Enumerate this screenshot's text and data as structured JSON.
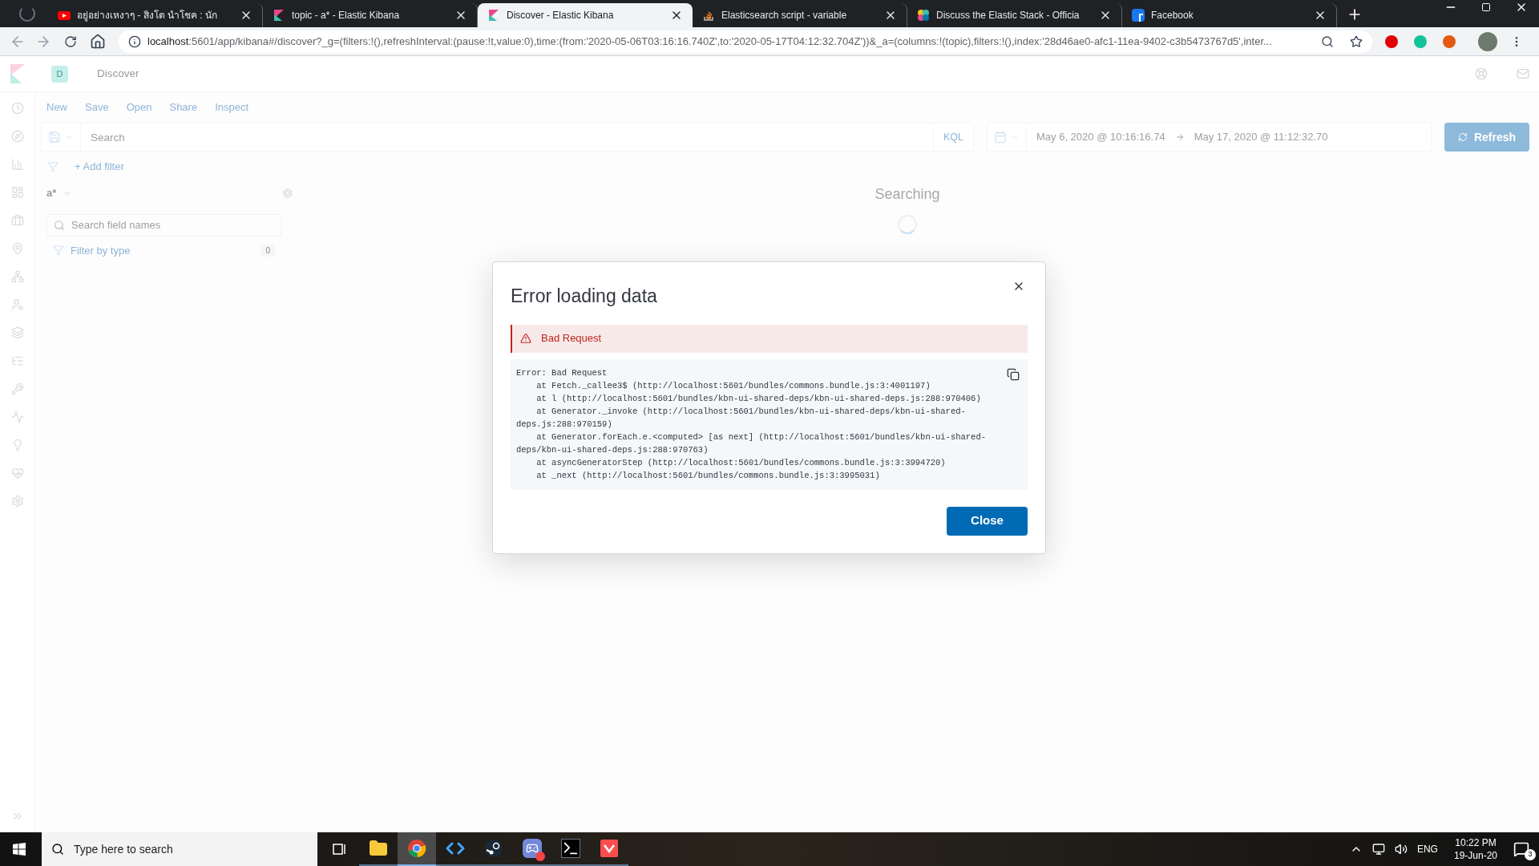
{
  "browser": {
    "tabs": [
      {
        "title": "อยู่อย่างเหงาๆ - สิงโต นำโชค : นัก",
        "selected": false
      },
      {
        "title": "topic - a* - Elastic Kibana",
        "selected": false
      },
      {
        "title": "Discover - Elastic Kibana",
        "selected": true
      },
      {
        "title": "Elasticsearch script - variable",
        "selected": false
      },
      {
        "title": "Discuss the Elastic Stack - Officia",
        "selected": false
      },
      {
        "title": "Facebook",
        "selected": false
      }
    ],
    "url_host": "localhost",
    "url_rest": ":5601/app/kibana#/discover?_g=(filters:!(),refreshInterval:(pause:!t,value:0),time:(from:'2020-05-06T03:16:16.740Z',to:'2020-05-17T04:12:32.704Z'))&_a=(columns:!(topic),filters:!(),index:'28d46ae0-afc1-11ea-9402-c3b5473767d5',inter..."
  },
  "kibana": {
    "space_avatar": "D",
    "title": "Discover",
    "top_nav": [
      "New",
      "Save",
      "Open",
      "Share",
      "Inspect"
    ],
    "query": {
      "placeholder": "Search",
      "language": "KQL"
    },
    "time": {
      "start": "May 6, 2020 @ 10:16:16.74",
      "end": "May 17, 2020 @ 11:12:32.70"
    },
    "refresh": "Refresh",
    "add_filter": "+ Add filter",
    "index_pattern": "a*",
    "field_search": {
      "placeholder": "Search field names"
    },
    "filter_by_type": {
      "label": "Filter by type",
      "count": "0"
    },
    "status": "Searching"
  },
  "modal": {
    "title": "Error loading data",
    "callout": "Bad Request",
    "trace": [
      "Error: Bad Request",
      "    at Fetch._callee3$ (http://localhost:5601/bundles/commons.bundle.js:3:4001197)",
      "    at l (http://localhost:5601/bundles/kbn-ui-shared-deps/kbn-ui-shared-deps.js:288:970406)",
      "    at Generator._invoke (http://localhost:5601/bundles/kbn-ui-shared-deps/kbn-ui-shared-deps.js:288:970159)",
      "    at Generator.forEach.e.<computed> [as next] (http://localhost:5601/bundles/kbn-ui-shared-deps/kbn-ui-shared-deps.js:288:970763)",
      "    at asyncGeneratorStep (http://localhost:5601/bundles/commons.bundle.js:3:3994720)",
      "    at _next (http://localhost:5601/bundles/commons.bundle.js:3:3995031)"
    ],
    "button": "Close"
  },
  "taskbar": {
    "search_placeholder": "Type here to search",
    "apps": [
      {
        "selected": false
      },
      {
        "selected": false
      },
      {
        "selected": true
      },
      {
        "selected": false
      },
      {
        "selected": false
      },
      {
        "selected": false
      },
      {
        "selected": false
      },
      {
        "selected": false
      }
    ],
    "language": "ENG",
    "time": "10:22 PM",
    "date": "19-Jun-20",
    "notifications": "3"
  }
}
